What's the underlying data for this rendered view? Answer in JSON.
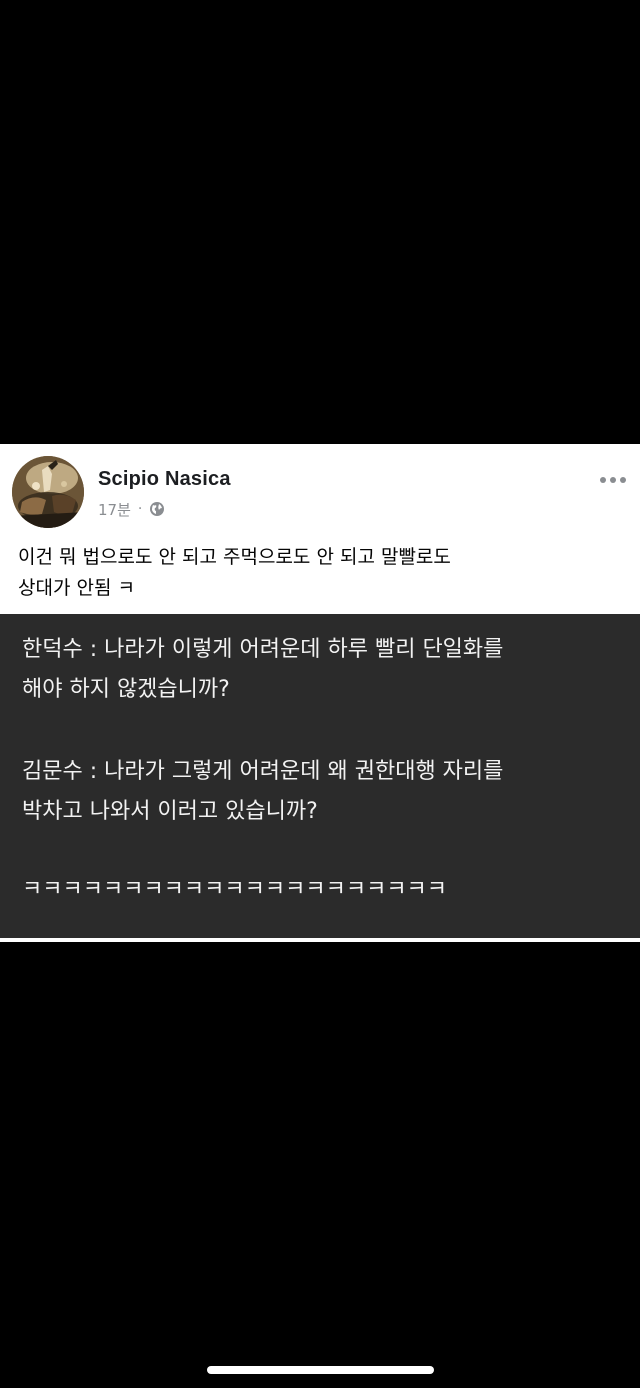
{
  "post": {
    "author": "Scipio Nasica",
    "time": "17분",
    "separator": "·",
    "audience_icon": "globe-icon",
    "more_icon": "more-horizontal-icon",
    "text_lines": [
      "이건 뭐 법으로도 안 되고 주먹으로도 안 되고 말빨로도",
      "상대가 안됨 ㅋ"
    ]
  },
  "image_card": {
    "lines": [
      "한덕수 : 나라가 이렇게 어려운데 하루 빨리 단일화를",
      "해야 하지 않겠습니까?",
      "김문수 : 나라가 그렇게 어려운데 왜 권한대행 자리를",
      "박차고 나와서 이러고 있습니까?",
      "ㅋㅋㅋㅋㅋㅋㅋㅋㅋㅋㅋㅋㅋㅋㅋㅋㅋㅋㅋㅋㅋ"
    ]
  },
  "colors": {
    "background": "#000000",
    "post_background": "#ffffff",
    "card_background": "#2b2b2b",
    "card_text": "#f2f2f2",
    "meta_text": "#8a8d91"
  }
}
